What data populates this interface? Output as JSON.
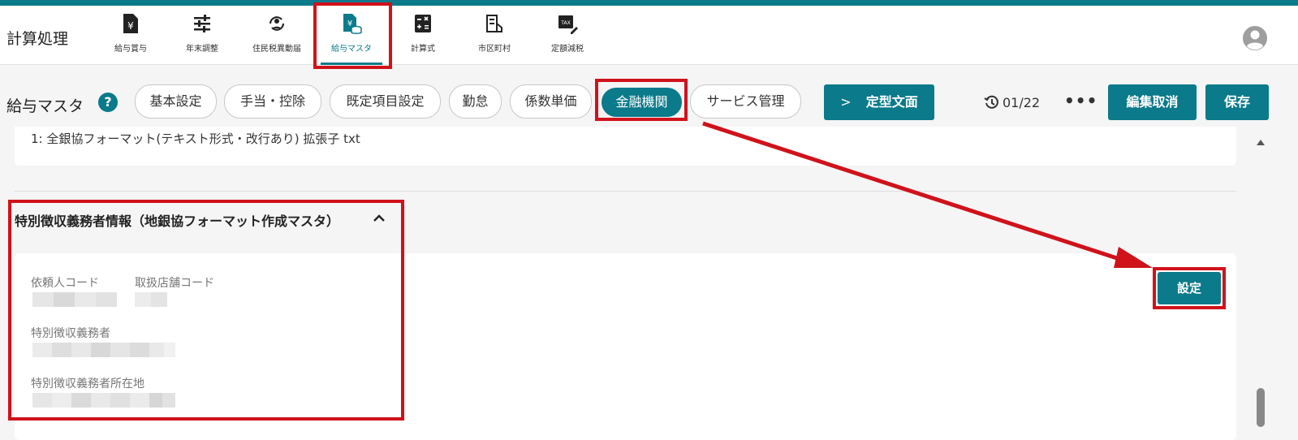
{
  "app": {
    "title": "計算処理"
  },
  "nav": {
    "items": [
      {
        "label": "給与賞与"
      },
      {
        "label": "年末調整"
      },
      {
        "label": "住民税異動届"
      },
      {
        "label": "給与マスタ"
      },
      {
        "label": "計算式"
      },
      {
        "label": "市区町村"
      },
      {
        "label": "定額減税"
      }
    ],
    "active_index": 3
  },
  "toolbar": {
    "page_title": "給与マスタ",
    "help_label": "?",
    "tabs": [
      {
        "label": "基本設定"
      },
      {
        "label": "手当・控除"
      },
      {
        "label": "既定項目設定"
      },
      {
        "label": "勤怠"
      },
      {
        "label": "係数単価"
      },
      {
        "label": "金融機関"
      },
      {
        "label": "サービス管理"
      }
    ],
    "active_tab_index": 5,
    "template_button": "定型文面",
    "template_chevron": ">",
    "history_label": "01/22",
    "more_label": "•••",
    "cancel_button": "編集取消",
    "save_button": "保存"
  },
  "content": {
    "format_text": "1: 全銀協フォーマット(テキスト形式・改行あり) 拡張子 txt",
    "section_title": "特別徴収義務者情報（地銀協フォーマット作成マスタ）",
    "settings_button": "設定",
    "fields": {
      "requester_code": "依頼人コード",
      "branch_code": "取扱店舗コード",
      "obligor": "特別徴収義務者",
      "obligor_address": "特別徴収義務者所在地"
    }
  },
  "colors": {
    "accent": "#0b7a8a",
    "highlight": "#d0121b",
    "background": "#f5f5f5"
  }
}
